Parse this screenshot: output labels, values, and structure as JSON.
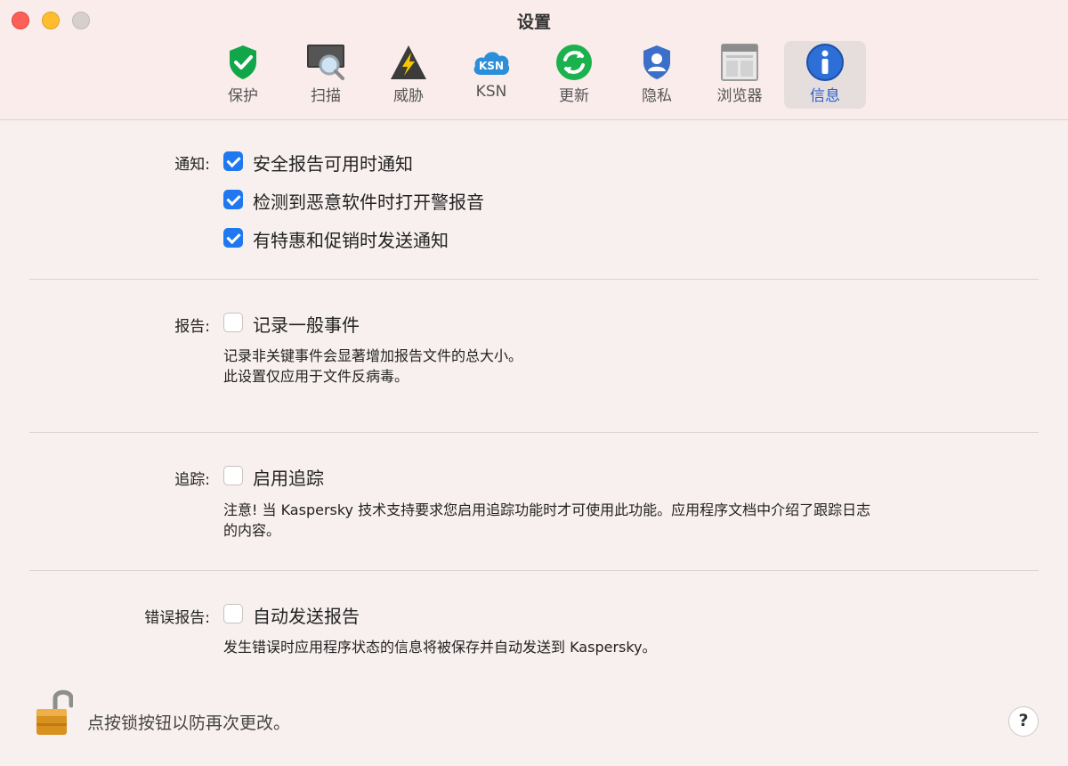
{
  "window": {
    "title": "设置"
  },
  "toolbar": {
    "items": [
      {
        "label": "保护",
        "icon": "shield-check-icon",
        "active": false
      },
      {
        "label": "扫描",
        "icon": "scan-magnifier-icon",
        "active": false
      },
      {
        "label": "威胁",
        "icon": "threat-warning-icon",
        "active": false
      },
      {
        "label": "KSN",
        "icon": "ksn-cloud-icon",
        "active": false
      },
      {
        "label": "更新",
        "icon": "update-refresh-icon",
        "active": false
      },
      {
        "label": "隐私",
        "icon": "privacy-shield-user-icon",
        "active": false
      },
      {
        "label": "浏览器",
        "icon": "browser-window-icon",
        "active": false
      },
      {
        "label": "信息",
        "icon": "info-icon",
        "active": true
      }
    ]
  },
  "notifications": {
    "label": "通知:",
    "options": [
      {
        "text": "安全报告可用时通知",
        "checked": true
      },
      {
        "text": "检测到恶意软件时打开警报音",
        "checked": true
      },
      {
        "text": "有特惠和促销时发送通知",
        "checked": true
      }
    ]
  },
  "reports": {
    "label": "报告:",
    "option": {
      "text": "记录一般事件",
      "checked": false
    },
    "note_line1": "记录非关键事件会显著增加报告文件的总大小。",
    "note_line2": "此设置仅应用于文件反病毒。"
  },
  "tracing": {
    "label": "追踪:",
    "option": {
      "text": "启用追踪",
      "checked": false
    },
    "note_line1": "注意! 当 Kaspersky 技术支持要求您启用追踪功能时才可使用此功能。应用程序文档中介绍了跟踪日志",
    "note_line2": "的内容。"
  },
  "error_reports": {
    "label": "错误报告:",
    "option": {
      "text": "自动发送报告",
      "checked": false
    },
    "note": "发生错误时应用程序状态的信息将被保存并自动发送到 Kaspersky。"
  },
  "footer": {
    "lock_text": "点按锁按钮以防再次更改。",
    "help_label": "?"
  },
  "colors": {
    "accent": "#1f78f0",
    "active_tab_text": "#2c5fd0",
    "shield_green": "#12a64a",
    "update_green": "#1cb14f",
    "info_blue": "#2d6fd6"
  }
}
